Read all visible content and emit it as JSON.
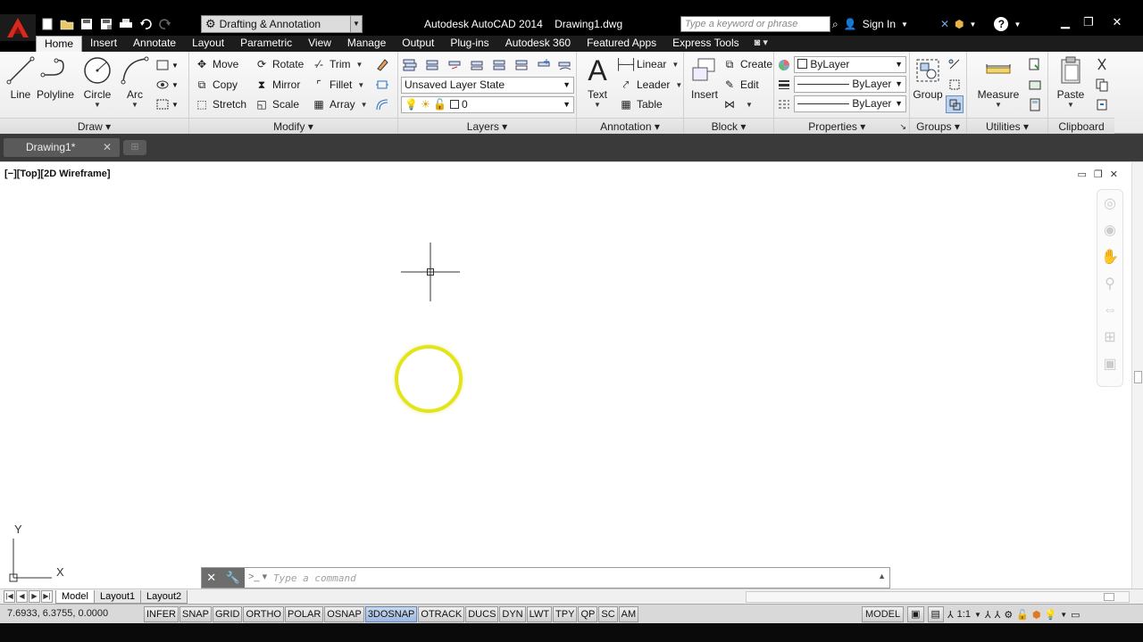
{
  "title": {
    "app_name": "Autodesk AutoCAD 2014",
    "document": "Drawing1.dwg",
    "workspace": "Drafting & Annotation",
    "search_placeholder": "Type a keyword or phrase",
    "sign_in": "Sign In"
  },
  "ribbon_tabs": [
    "Home",
    "Insert",
    "Annotate",
    "Layout",
    "Parametric",
    "View",
    "Manage",
    "Output",
    "Plug-ins",
    "Autodesk 360",
    "Featured Apps",
    "Express Tools"
  ],
  "active_tab": "Home",
  "panels": {
    "draw": {
      "title": "Draw",
      "line": "Line",
      "polyline": "Polyline",
      "circle": "Circle",
      "arc": "Arc"
    },
    "modify": {
      "title": "Modify",
      "move": "Move",
      "rotate": "Rotate",
      "trim": "Trim",
      "copy": "Copy",
      "mirror": "Mirror",
      "fillet": "Fillet",
      "stretch": "Stretch",
      "scale": "Scale",
      "array": "Array"
    },
    "layers": {
      "title": "Layers",
      "layer_state": "Unsaved Layer State",
      "current_layer": "0"
    },
    "annotation": {
      "title": "Annotation",
      "text": "Text",
      "linear": "Linear",
      "leader": "Leader",
      "table": "Table"
    },
    "block": {
      "title": "Block",
      "insert": "Insert",
      "create": "Create",
      "edit": "Edit"
    },
    "properties": {
      "title": "Properties",
      "color": "ByLayer",
      "linetype": "ByLayer",
      "lineweight": "ByLayer"
    },
    "groups": {
      "title": "Groups",
      "group": "Group"
    },
    "utilities": {
      "title": "Utilities",
      "measure": "Measure"
    },
    "clipboard": {
      "title": "Clipboard",
      "paste": "Paste"
    }
  },
  "file_tab": {
    "name": "Drawing1*"
  },
  "viewport": {
    "label": "[−][Top][2D Wireframe]"
  },
  "ucs": {
    "x_label": "X",
    "y_label": "Y"
  },
  "command_line": {
    "placeholder": "Type a command"
  },
  "layout_tabs": [
    "Model",
    "Layout1",
    "Layout2"
  ],
  "status": {
    "coordinates": "7.6933, 6.3755, 0.0000",
    "toggles": [
      {
        "label": "INFER",
        "on": false
      },
      {
        "label": "SNAP",
        "on": false
      },
      {
        "label": "GRID",
        "on": false
      },
      {
        "label": "ORTHO",
        "on": false
      },
      {
        "label": "POLAR",
        "on": false
      },
      {
        "label": "OSNAP",
        "on": false
      },
      {
        "label": "3DOSNAP",
        "on": true
      },
      {
        "label": "OTRACK",
        "on": false
      },
      {
        "label": "DUCS",
        "on": false
      },
      {
        "label": "DYN",
        "on": false
      },
      {
        "label": "LWT",
        "on": false
      },
      {
        "label": "TPY",
        "on": false
      },
      {
        "label": "QP",
        "on": false
      },
      {
        "label": "SC",
        "on": false
      },
      {
        "label": "AM",
        "on": false
      }
    ],
    "model": "MODEL",
    "annotation_scale": "1:1"
  }
}
